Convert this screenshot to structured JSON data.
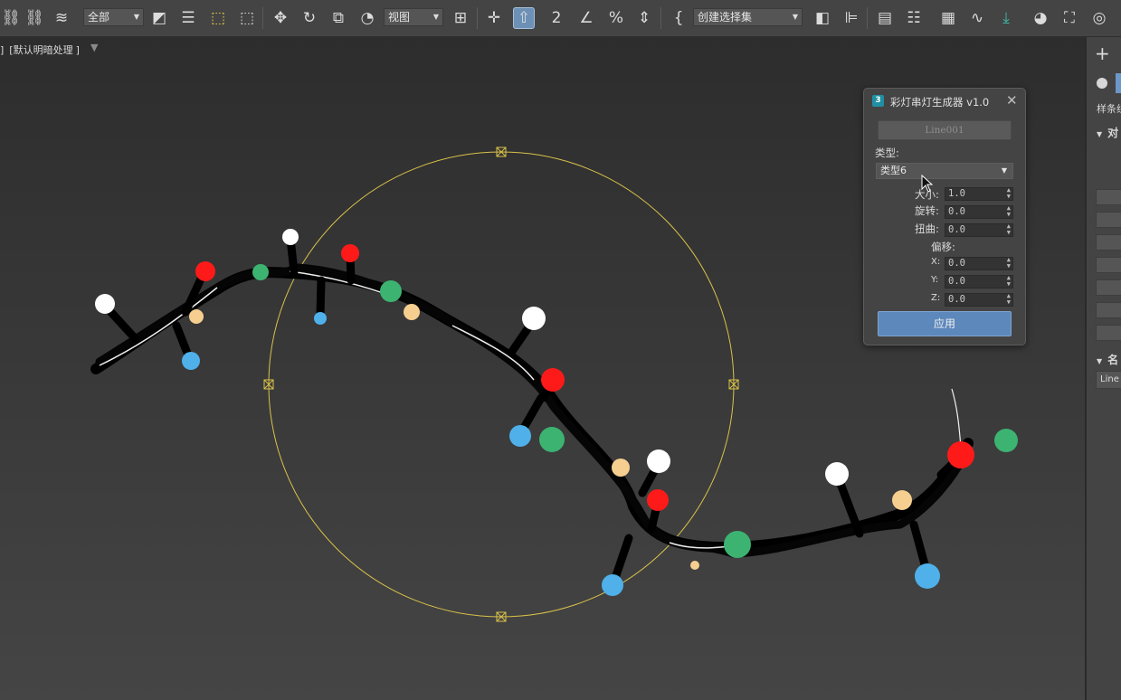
{
  "toolbar": {
    "selection_filter": "全部",
    "coord_system": "视图",
    "selection_set": "创建选择集"
  },
  "viewport": {
    "label_parts": [
      "[",
      "默认明暗处理",
      "]"
    ],
    "label_lead": "]"
  },
  "dialog": {
    "logo": "3",
    "title": "彩灯串灯生成器 v1.0",
    "pick_button": "Line001",
    "type_label": "类型:",
    "type_value": "类型6",
    "size_label": "大小:",
    "size_value": "1.0",
    "rotate_label": "旋转:",
    "rotate_value": "0.0",
    "twist_label": "扭曲:",
    "twist_value": "0.0",
    "offset_label": "偏移:",
    "x_label": "X:",
    "x_value": "0.0",
    "y_label": "Y:",
    "y_value": "0.0",
    "z_label": "Z:",
    "z_value": "0.0",
    "apply_button": "应用"
  },
  "command_panel": {
    "tab_text": "样条线",
    "rollout1": "对",
    "rollout2": "名",
    "name_field": "Line"
  },
  "colors": {
    "bulb_red": "#ff1a1a",
    "bulb_green": "#3cb371",
    "bulb_white": "#ffffff",
    "bulb_blue": "#4fb0ea",
    "bulb_yellow": "#f6cf90",
    "gizmo": "#d9c24a",
    "accent": "#5d88bc"
  }
}
